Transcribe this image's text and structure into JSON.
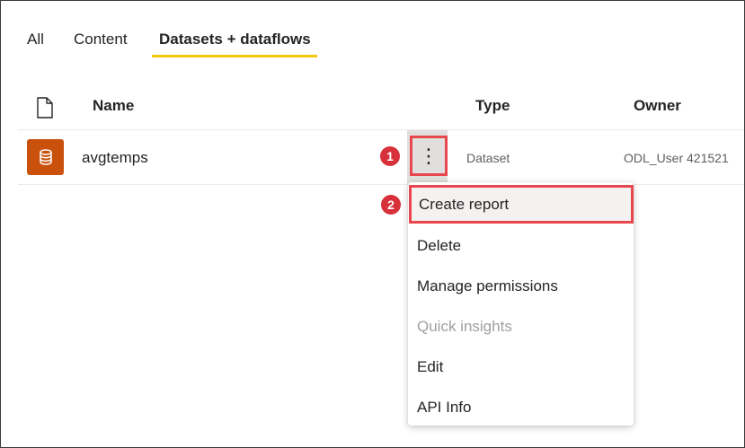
{
  "tabs": {
    "all": "All",
    "content": "Content",
    "datasets": "Datasets + dataflows",
    "active": "Datasets + dataflows"
  },
  "columns": {
    "name": "Name",
    "type": "Type",
    "owner": "Owner"
  },
  "rows": [
    {
      "name": "avgtemps",
      "type": "Dataset",
      "owner": "ODL_User 421521",
      "icon": "dataset-icon"
    }
  ],
  "more_button": {
    "label": "⋮",
    "icon": "more-vertical-icon"
  },
  "callouts": {
    "step1": "1",
    "step2": "2"
  },
  "context_menu": {
    "items": [
      {
        "label": "Create report",
        "highlighted": true
      },
      {
        "label": "Delete"
      },
      {
        "label": "Manage permissions"
      },
      {
        "label": "Quick insights",
        "disabled": true
      },
      {
        "label": "Edit"
      },
      {
        "label": "API Info"
      }
    ]
  },
  "colors": {
    "tab_underline": "#f2c811",
    "dataset_icon_bg": "#c9510c",
    "callout_badge": "#d8303a",
    "highlight_border": "#e8474e"
  }
}
